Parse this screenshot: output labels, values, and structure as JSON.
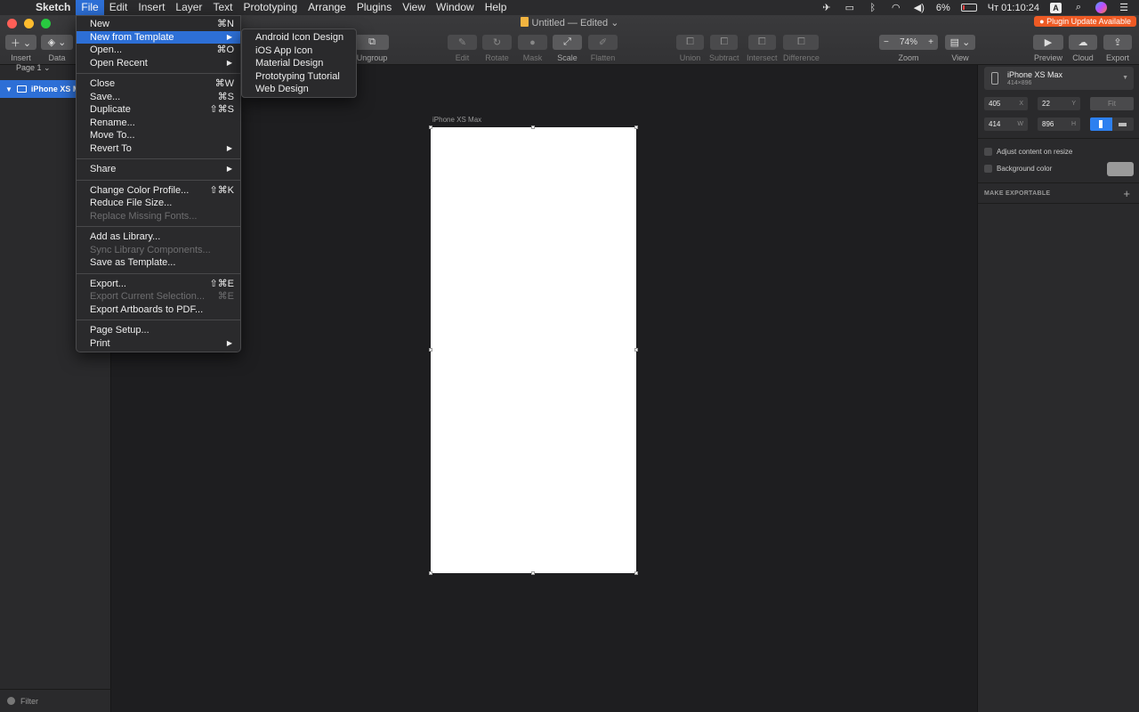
{
  "menubar": {
    "items": [
      "Sketch",
      "File",
      "Edit",
      "Insert",
      "Layer",
      "Text",
      "Prototyping",
      "Arrange",
      "Plugins",
      "View",
      "Window",
      "Help"
    ],
    "active": "File",
    "battery": "6%",
    "clock": "Чт 01:10:24",
    "input_source": "A"
  },
  "window": {
    "title": "Untitled — Edited",
    "plugin_badge": "● Plugin Update Available"
  },
  "toolbar": {
    "insert": "Insert",
    "data": "Data",
    "ungroup": "Ungroup",
    "edit": "Edit",
    "rotate": "Rotate",
    "mask": "Mask",
    "scale": "Scale",
    "flatten": "Flatten",
    "union": "Union",
    "subtract": "Subtract",
    "intersect": "Intersect",
    "difference": "Difference",
    "zoom": "Zoom",
    "zoom_value": "74%",
    "view": "View",
    "preview": "Preview",
    "cloud": "Cloud",
    "export": "Export"
  },
  "sidebar": {
    "page": "Page 1",
    "layer": "iPhone XS Max",
    "filter": "Filter"
  },
  "canvas": {
    "artboard_label": "iPhone XS Max"
  },
  "inspector": {
    "preset_name": "iPhone XS Max",
    "preset_size": "414×896",
    "x": "405",
    "x_label": "X",
    "y": "22",
    "y_label": "Y",
    "w": "414",
    "w_label": "W",
    "h": "896",
    "h_label": "H",
    "fit": "Fit",
    "adjust": "Adjust content on resize",
    "background": "Background color",
    "exportable": "MAKE EXPORTABLE"
  },
  "file_menu": [
    {
      "label": "New",
      "shortcut": "⌘N"
    },
    {
      "label": "New from Template",
      "submenu": true,
      "highlighted": true
    },
    {
      "label": "Open...",
      "shortcut": "⌘O"
    },
    {
      "label": "Open Recent",
      "submenu": true
    },
    {
      "sep": true
    },
    {
      "label": "Close",
      "shortcut": "⌘W"
    },
    {
      "label": "Save...",
      "shortcut": "⌘S"
    },
    {
      "label": "Duplicate",
      "shortcut": "⇧⌘S"
    },
    {
      "label": "Rename..."
    },
    {
      "label": "Move To..."
    },
    {
      "label": "Revert To",
      "submenu": true
    },
    {
      "sep": true
    },
    {
      "label": "Share",
      "submenu": true
    },
    {
      "sep": true
    },
    {
      "label": "Change Color Profile...",
      "shortcut": "⇧⌘K"
    },
    {
      "label": "Reduce File Size..."
    },
    {
      "label": "Replace Missing Fonts...",
      "disabled": true
    },
    {
      "sep": true
    },
    {
      "label": "Add as Library..."
    },
    {
      "label": "Sync Library Components...",
      "disabled": true
    },
    {
      "label": "Save as Template..."
    },
    {
      "sep": true
    },
    {
      "label": "Export...",
      "shortcut": "⇧⌘E"
    },
    {
      "label": "Export Current Selection...",
      "shortcut": "⌘E",
      "disabled": true
    },
    {
      "label": "Export Artboards to PDF..."
    },
    {
      "sep": true
    },
    {
      "label": "Page Setup..."
    },
    {
      "label": "Print",
      "submenu": true
    }
  ],
  "template_submenu": [
    "Android Icon Design",
    "iOS App Icon",
    "Material Design",
    "Prototyping Tutorial",
    "Web Design"
  ],
  "colors": {
    "accent": "#2d6fd6",
    "badge": "#ee5a24",
    "close": "#fe5f57",
    "minimize": "#febc2e",
    "maximize": "#28c840"
  }
}
